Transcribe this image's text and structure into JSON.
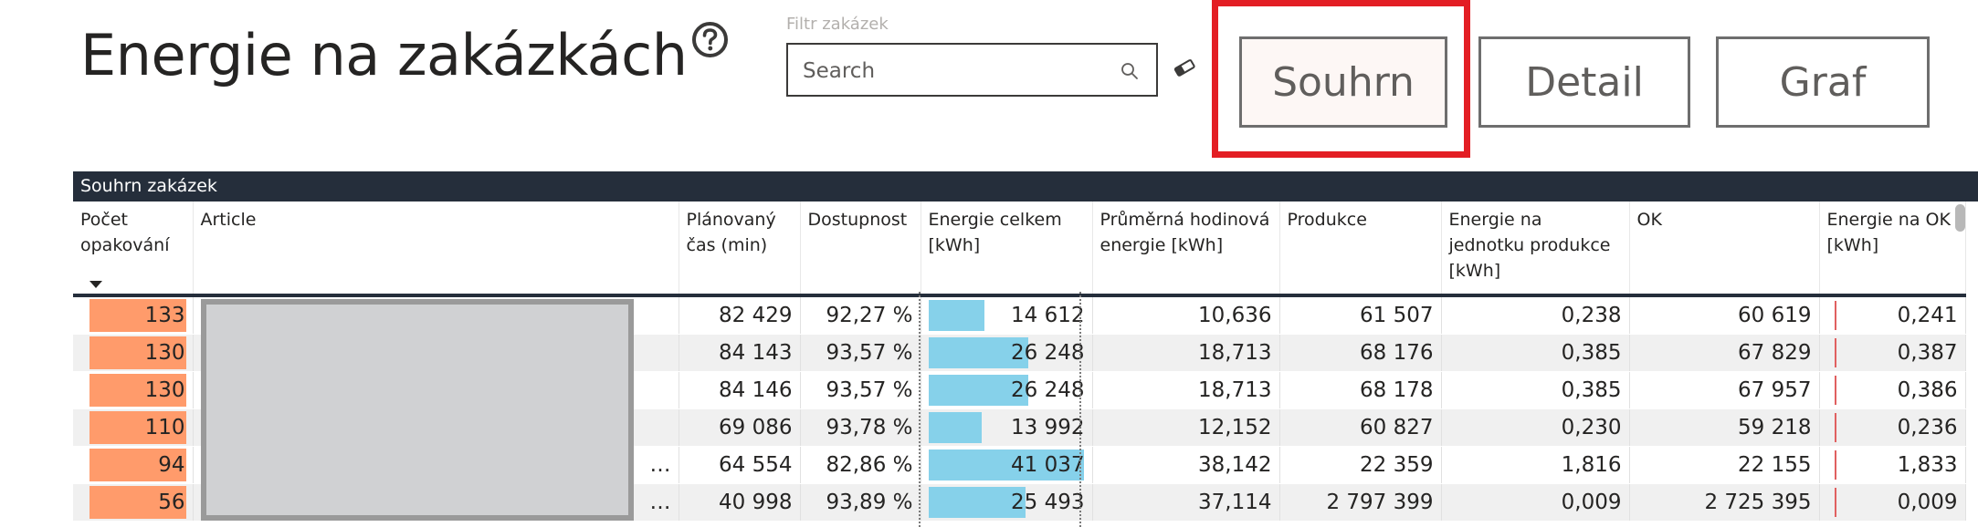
{
  "page": {
    "title": "Energie na zakázkách",
    "help_icon": "question-circle-icon"
  },
  "filter": {
    "label": "Filtr zakázek",
    "placeholder": "Search",
    "value": "",
    "search_icon": "search-icon",
    "clear_icon": "eraser-icon"
  },
  "nav": {
    "summary_label": "Souhrn",
    "detail_label": "Detail",
    "graph_label": "Graf"
  },
  "table": {
    "panel_title": "Souhrn zakázek",
    "columns": [
      "Počet opakování",
      "Article",
      "Plánovaný čas (min)",
      "Dostupnost",
      "Energie celkem [kWh]",
      "Průměrná hodinová energie [kWh]",
      "Produkce",
      "Energie na jednotku produkce [kWh]",
      "OK",
      "Energie na OK [kWh]"
    ],
    "rows": [
      {
        "count": "133",
        "article": "",
        "plan": "82 429",
        "avail": "92,27 %",
        "energy": "14 612",
        "energy_fraction": 0.356,
        "avg": "10,636",
        "prod": "61 507",
        "per_unit": "0,238",
        "ok": "60 619",
        "per_ok": "0,241"
      },
      {
        "count": "130",
        "article": "",
        "plan": "84 143",
        "avail": "93,57 %",
        "energy": "26 248",
        "energy_fraction": 0.64,
        "avg": "18,713",
        "prod": "68 176",
        "per_unit": "0,385",
        "ok": "67 829",
        "per_ok": "0,387"
      },
      {
        "count": "130",
        "article": "",
        "plan": "84 146",
        "avail": "93,57 %",
        "energy": "26 248",
        "energy_fraction": 0.64,
        "avg": "18,713",
        "prod": "68 178",
        "per_unit": "0,385",
        "ok": "67 957",
        "per_ok": "0,386"
      },
      {
        "count": "110",
        "article": "",
        "plan": "69 086",
        "avail": "93,78 %",
        "energy": "13 992",
        "energy_fraction": 0.341,
        "avg": "12,152",
        "prod": "60 827",
        "per_unit": "0,230",
        "ok": "59 218",
        "per_ok": "0,236"
      },
      {
        "count": "94",
        "article": "…",
        "plan": "64 554",
        "avail": "82,86 %",
        "energy": "41 037",
        "energy_fraction": 1.0,
        "avg": "38,142",
        "prod": "22 359",
        "per_unit": "1,816",
        "ok": "22 155",
        "per_ok": "1,833"
      },
      {
        "count": "56",
        "article": "…",
        "plan": "40 998",
        "avail": "93,89 %",
        "energy": "25 493",
        "energy_fraction": 0.621,
        "avg": "37,114",
        "prod": "2 797 399",
        "per_unit": "0,009",
        "ok": "2 725 395",
        "per_ok": "0,009"
      }
    ]
  },
  "colors": {
    "count_bar": "#ff9b6b",
    "energy_bar": "#86d1ea",
    "header_bg": "#252e3b",
    "highlight": "#e31e24"
  }
}
